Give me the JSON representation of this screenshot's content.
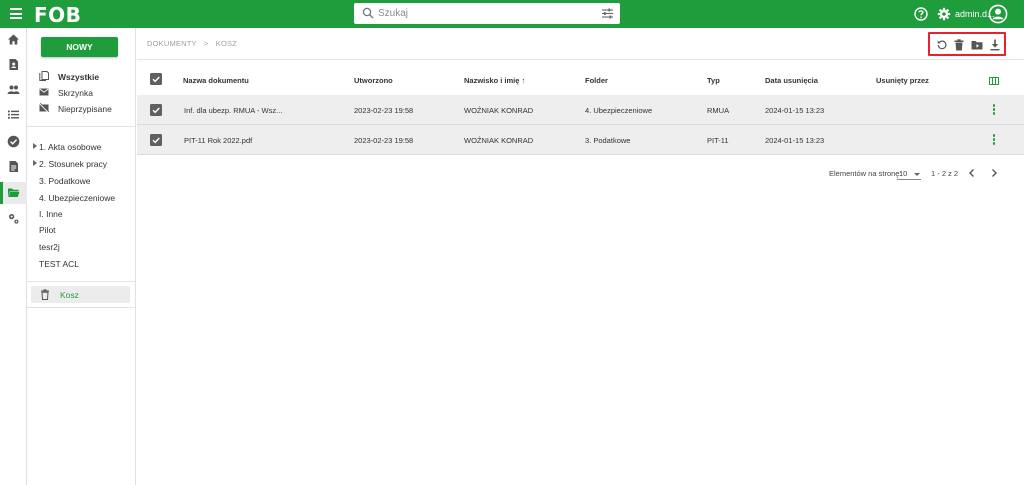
{
  "app": {
    "logo": "FOB"
  },
  "search": {
    "placeholder": "Szukaj"
  },
  "header": {
    "user_name": "admin.d..."
  },
  "sidebar": {
    "new_button": "NOWY",
    "views": [
      {
        "label": "Wszystkie",
        "icon": "documents-icon",
        "bold": true
      },
      {
        "label": "Skrzynka",
        "icon": "mail-icon"
      },
      {
        "label": "Nieprzypisane",
        "icon": "unassigned-mail-icon"
      }
    ],
    "folders": [
      {
        "label": "1. Akta osobowe",
        "expandable": true
      },
      {
        "label": "2. Stosunek pracy",
        "expandable": true
      },
      {
        "label": "3. Podatkowe"
      },
      {
        "label": "4. Ubezpieczeniowe"
      },
      {
        "label": "I. Inne"
      },
      {
        "label": "Pilot"
      },
      {
        "label": "tesr2j"
      },
      {
        "label": "TEST ACL"
      }
    ],
    "trash": "Kosz"
  },
  "breadcrumb": {
    "root": "DOKUMENTY",
    "separator": ">",
    "current": "KOSZ"
  },
  "table": {
    "columns": {
      "name": "Nazwa dokumentu",
      "created": "Utworzono",
      "person": "Nazwisko i imię ↑",
      "folder": "Folder",
      "type": "Typ",
      "deleted_date": "Data usunięcia",
      "deleted_by": "Usunięty przez"
    },
    "rows": [
      {
        "name": "Inf. dla ubezp. RMUA - Wsz...",
        "created": "2023-02-23 19:58",
        "person": "WOŹNIAK KONRAD",
        "folder": "4. Ubezpieczeniowe",
        "type": "RMUA",
        "deleted_date": "2024-01-15 13:23",
        "deleted_by": ""
      },
      {
        "name": "PIT-11 Rok 2022.pdf",
        "created": "2023-02-23 19:58",
        "person": "WOŹNIAK KONRAD",
        "folder": "3. Podatkowe",
        "type": "PIT-11",
        "deleted_date": "2024-01-15 13:23",
        "deleted_by": ""
      }
    ]
  },
  "pager": {
    "per_page_label": "Elementów na stronę:",
    "per_page_value": "10",
    "range": "1 - 2 z 2"
  },
  "colors": {
    "brand": "#1f9d3c",
    "highlight": "#e8222a",
    "row_bg": "#eeeeee"
  }
}
